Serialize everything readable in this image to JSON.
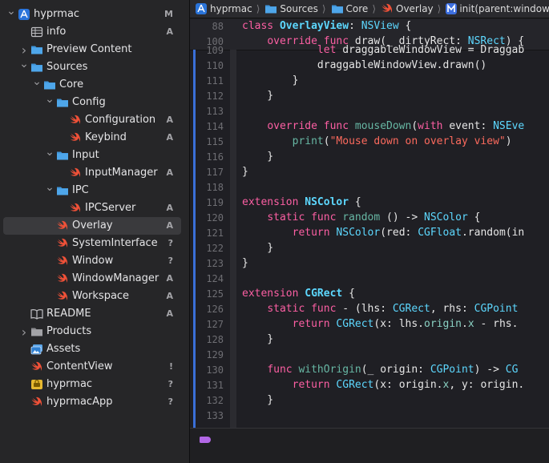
{
  "navigator": {
    "items": [
      {
        "label": "hyprmac",
        "badge": "M",
        "depth": 0,
        "chev": "down",
        "icon": "app-project-icon"
      },
      {
        "label": "info",
        "badge": "A",
        "depth": 1,
        "chev": "",
        "icon": "plist-table-icon"
      },
      {
        "label": "Preview Content",
        "badge": "",
        "depth": 1,
        "chev": "right",
        "icon": "folder-icon"
      },
      {
        "label": "Sources",
        "badge": "",
        "depth": 1,
        "chev": "down",
        "icon": "folder-icon"
      },
      {
        "label": "Core",
        "badge": "",
        "depth": 2,
        "chev": "down",
        "icon": "folder-icon"
      },
      {
        "label": "Config",
        "badge": "",
        "depth": 3,
        "chev": "down",
        "icon": "folder-icon"
      },
      {
        "label": "Configuration",
        "badge": "A",
        "depth": 4,
        "chev": "",
        "icon": "swift-file-icon"
      },
      {
        "label": "Keybind",
        "badge": "A",
        "depth": 4,
        "chev": "",
        "icon": "swift-file-icon"
      },
      {
        "label": "Input",
        "badge": "",
        "depth": 3,
        "chev": "down",
        "icon": "folder-icon"
      },
      {
        "label": "InputManager",
        "badge": "A",
        "depth": 4,
        "chev": "",
        "icon": "swift-file-icon"
      },
      {
        "label": "IPC",
        "badge": "",
        "depth": 3,
        "chev": "down",
        "icon": "folder-icon"
      },
      {
        "label": "IPCServer",
        "badge": "A",
        "depth": 4,
        "chev": "",
        "icon": "swift-file-icon"
      },
      {
        "label": "Overlay",
        "badge": "A",
        "depth": 3,
        "chev": "",
        "icon": "swift-file-icon",
        "selected": true
      },
      {
        "label": "SystemInterface",
        "badge": "?",
        "depth": 3,
        "chev": "",
        "icon": "swift-file-icon"
      },
      {
        "label": "Window",
        "badge": "?",
        "depth": 3,
        "chev": "",
        "icon": "swift-file-icon"
      },
      {
        "label": "WindowManager",
        "badge": "A",
        "depth": 3,
        "chev": "",
        "icon": "swift-file-icon"
      },
      {
        "label": "Workspace",
        "badge": "A",
        "depth": 3,
        "chev": "",
        "icon": "swift-file-icon"
      },
      {
        "label": "README",
        "badge": "A",
        "depth": 1,
        "chev": "",
        "icon": "book-icon"
      },
      {
        "label": "Products",
        "badge": "",
        "depth": 1,
        "chev": "right",
        "icon": "folder-gray-icon"
      },
      {
        "label": "Assets",
        "badge": "",
        "depth": 1,
        "chev": "",
        "icon": "asset-catalog-icon"
      },
      {
        "label": "ContentView",
        "badge": "!",
        "depth": 1,
        "chev": "",
        "icon": "swift-file-icon"
      },
      {
        "label": "hyprmac",
        "badge": "?",
        "depth": 1,
        "chev": "",
        "icon": "entitlements-icon"
      },
      {
        "label": "hyprmacApp",
        "badge": "?",
        "depth": 1,
        "chev": "",
        "icon": "swift-file-icon"
      }
    ]
  },
  "jumpbar": {
    "crumbs": [
      {
        "label": "hyprmac",
        "icon": "app-project-icon"
      },
      {
        "label": "Sources",
        "icon": "folder-icon"
      },
      {
        "label": "Core",
        "icon": "folder-icon"
      },
      {
        "label": "Overlay",
        "icon": "swift-file-icon"
      },
      {
        "label": "init(parent:window:)",
        "icon": "method-icon"
      }
    ]
  },
  "sticky": [
    {
      "n": "88",
      "tokens": [
        [
          "kw",
          "class "
        ],
        [
          "decl",
          "OverlayView"
        ],
        [
          "",
          "‌: "
        ],
        [
          "ty",
          "NSView"
        ],
        [
          "",
          " {"
        ]
      ]
    },
    {
      "n": "100",
      "tokens": [
        [
          "",
          "    "
        ],
        [
          "kw",
          "override func "
        ],
        [
          "",
          "draw(_ dirtyRect: "
        ],
        [
          "ty",
          "NSRect"
        ],
        [
          "",
          ") {"
        ]
      ]
    }
  ],
  "code": [
    {
      "n": "109",
      "tokens": [
        [
          "",
          "            "
        ],
        [
          "kw",
          "let "
        ],
        [
          "",
          "draggableWindowView = Draggab"
        ]
      ]
    },
    {
      "n": "110",
      "tokens": [
        [
          "",
          "            draggableWindowView.drawn()"
        ]
      ]
    },
    {
      "n": "111",
      "tokens": [
        [
          "",
          "        }"
        ]
      ]
    },
    {
      "n": "112",
      "tokens": [
        [
          "",
          "    }"
        ]
      ]
    },
    {
      "n": "113",
      "tokens": []
    },
    {
      "n": "114",
      "tokens": [
        [
          "",
          "    "
        ],
        [
          "kw",
          "override func "
        ],
        [
          "fn",
          "mouseDown"
        ],
        [
          "",
          "("
        ],
        [
          "kw",
          "with "
        ],
        [
          "",
          "event: "
        ],
        [
          "ty",
          "NSEve"
        ]
      ]
    },
    {
      "n": "115",
      "tokens": [
        [
          "",
          "        "
        ],
        [
          "fn",
          "print"
        ],
        [
          "",
          "("
        ],
        [
          "str",
          "\"Mouse down on overlay view\""
        ],
        [
          "",
          ")"
        ]
      ]
    },
    {
      "n": "116",
      "tokens": [
        [
          "",
          "    }"
        ]
      ]
    },
    {
      "n": "117",
      "tokens": [
        [
          "",
          "}"
        ]
      ]
    },
    {
      "n": "118",
      "tokens": []
    },
    {
      "n": "119",
      "tokens": [
        [
          "kw",
          "extension "
        ],
        [
          "decl",
          "NSColor"
        ],
        [
          "",
          " {"
        ]
      ]
    },
    {
      "n": "120",
      "tokens": [
        [
          "",
          "    "
        ],
        [
          "kw",
          "static func "
        ],
        [
          "fn",
          "random"
        ],
        [
          "",
          " () -> "
        ],
        [
          "ty",
          "NSColor"
        ],
        [
          "",
          " {"
        ]
      ]
    },
    {
      "n": "121",
      "tokens": [
        [
          "",
          "        "
        ],
        [
          "kw",
          "return "
        ],
        [
          "ty",
          "NSColor"
        ],
        [
          "",
          "(red: "
        ],
        [
          "ty",
          "CGFloat"
        ],
        [
          "",
          ".random(in"
        ]
      ]
    },
    {
      "n": "122",
      "tokens": [
        [
          "",
          "    }"
        ]
      ]
    },
    {
      "n": "123",
      "tokens": [
        [
          "",
          "}"
        ]
      ]
    },
    {
      "n": "124",
      "tokens": []
    },
    {
      "n": "125",
      "tokens": [
        [
          "kw",
          "extension "
        ],
        [
          "decl",
          "CGRect"
        ],
        [
          "",
          " {"
        ]
      ]
    },
    {
      "n": "126",
      "tokens": [
        [
          "",
          "    "
        ],
        [
          "kw",
          "static func "
        ],
        [
          "",
          "- (lhs: "
        ],
        [
          "ty",
          "CGRect"
        ],
        [
          "",
          ", rhs: "
        ],
        [
          "ty",
          "CGPoint"
        ]
      ]
    },
    {
      "n": "127",
      "tokens": [
        [
          "",
          "        "
        ],
        [
          "kw",
          "return "
        ],
        [
          "ty",
          "CGRect"
        ],
        [
          "",
          "(x: lhs."
        ],
        [
          "tyd",
          "origin"
        ],
        [
          "",
          "."
        ],
        [
          "tyd",
          "x"
        ],
        [
          "",
          " - rhs."
        ]
      ]
    },
    {
      "n": "128",
      "tokens": [
        [
          "",
          "    }"
        ]
      ]
    },
    {
      "n": "129",
      "tokens": []
    },
    {
      "n": "130",
      "tokens": [
        [
          "",
          "    "
        ],
        [
          "kw",
          "func "
        ],
        [
          "fn",
          "withOrigin"
        ],
        [
          "",
          "(_ origin: "
        ],
        [
          "ty",
          "CGPoint"
        ],
        [
          "",
          ") -> "
        ],
        [
          "ty",
          "CG"
        ]
      ]
    },
    {
      "n": "131",
      "tokens": [
        [
          "",
          "        "
        ],
        [
          "kw",
          "return "
        ],
        [
          "ty",
          "CGRect"
        ],
        [
          "",
          "(x: origin."
        ],
        [
          "tyd",
          "x"
        ],
        [
          "",
          ", y: origin."
        ]
      ]
    },
    {
      "n": "132",
      "tokens": [
        [
          "",
          "    }"
        ]
      ]
    },
    {
      "n": "133",
      "tokens": []
    }
  ]
}
